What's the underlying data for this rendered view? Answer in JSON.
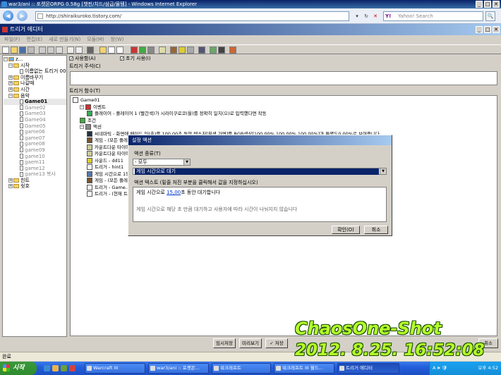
{
  "ie": {
    "title": "war3/ani :: 포켓몬ORPG 0.58g [챗핀/치드/삼급/물템] - Windows Internet Explorer",
    "back": "◀",
    "forward": "▶",
    "url": "http://shiraikuroko.tistory.com/",
    "refresh": "↻",
    "stop": "✕",
    "search_placeholder": "Yahoo! Search",
    "search_logo": "Y!",
    "search_go": "🔍",
    "window_controls": [
      "_",
      "□",
      "✕"
    ]
  },
  "editor": {
    "title": "트리거 에디터",
    "window_controls": [
      "_",
      "□",
      "✕"
    ],
    "menu": [
      "파일(F)",
      "편집(E)",
      "새로 만들기(N)",
      "모듈(M)",
      "창(W)"
    ],
    "tree": [
      {
        "label": "z...",
        "icon": "map-icon",
        "expand": "−",
        "indent": 0
      },
      {
        "label": "시작",
        "icon": "folder-icon",
        "expand": "−",
        "indent": 1
      },
      {
        "label": "이름없는 트리거 006",
        "icon": "trigger-icon",
        "expand": "",
        "indent": 2
      },
      {
        "label": "이름바꾸기",
        "icon": "folder-icon",
        "expand": "+",
        "indent": 1
      },
      {
        "label": "나갈때",
        "icon": "folder-icon",
        "expand": "+",
        "indent": 1
      },
      {
        "label": "시간",
        "icon": "folder-icon",
        "expand": "+",
        "indent": 1
      },
      {
        "label": "음악",
        "icon": "folder-icon",
        "expand": "−",
        "indent": 1
      },
      {
        "label": "Game01",
        "icon": "trigger-icon",
        "expand": "",
        "indent": 2,
        "selected": true
      },
      {
        "label": "Game02",
        "icon": "trigger-icon",
        "expand": "",
        "indent": 2,
        "gray": true
      },
      {
        "label": "Game03",
        "icon": "trigger-icon",
        "expand": "",
        "indent": 2,
        "gray": true
      },
      {
        "label": "Game04",
        "icon": "trigger-icon",
        "expand": "",
        "indent": 2,
        "gray": true
      },
      {
        "label": "Game05",
        "icon": "trigger-icon",
        "expand": "",
        "indent": 2,
        "gray": true
      },
      {
        "label": "game06",
        "icon": "trigger-icon",
        "expand": "",
        "indent": 2,
        "gray": true
      },
      {
        "label": "game07",
        "icon": "trigger-icon",
        "expand": "",
        "indent": 2,
        "gray": true
      },
      {
        "label": "game08",
        "icon": "trigger-icon",
        "expand": "",
        "indent": 2,
        "gray": true
      },
      {
        "label": "game09",
        "icon": "trigger-icon",
        "expand": "",
        "indent": 2,
        "gray": true
      },
      {
        "label": "game10",
        "icon": "trigger-icon",
        "expand": "",
        "indent": 2,
        "gray": true
      },
      {
        "label": "gaem11",
        "icon": "trigger-icon",
        "expand": "",
        "indent": 2,
        "gray": true
      },
      {
        "label": "game12",
        "icon": "trigger-icon",
        "expand": "",
        "indent": 2,
        "gray": true
      },
      {
        "label": "game13 복사",
        "icon": "trigger-icon",
        "expand": "",
        "indent": 2,
        "gray": true
      },
      {
        "label": "힌트",
        "icon": "folder-icon",
        "expand": "+",
        "indent": 1
      },
      {
        "label": "쉿호",
        "icon": "folder-icon",
        "expand": "+",
        "indent": 1
      }
    ],
    "enabled_label": "사용함(A)",
    "initial_on_label": "초기 사용(I)",
    "check_mark": "✓",
    "comment_label": "트리거 주석(C)",
    "functions_label": "트리거 함수(T)",
    "functions": [
      {
        "text": "Game01",
        "icon": "trigger-icon",
        "indent": 0
      },
      {
        "text": "이벤트",
        "icon": "event-icon",
        "indent": 1,
        "expand": "−"
      },
      {
        "text": "플레이어 - 플레이어 1 (빨간색)가 시라이쿠로코(을)를 정확히 일치(으)로 입력했다면 작동",
        "icon": "player-icon",
        "indent": 2
      },
      {
        "text": "조건",
        "icon": "condition-icon",
        "indent": 1,
        "expand": ""
      },
      {
        "text": "액션",
        "icon": "action-icon",
        "indent": 1,
        "expand": "−"
      },
      {
        "text": "씨네마틱 - 화면에 페이드 인(출)를 100,00초 동안 텍스처[흰색 가면]를 RGB색상[100,00%,100,00%,100,00%]과 투명도0,00%로 보여줍니다",
        "icon": "cinematic-icon",
        "indent": 2
      },
      {
        "text": "게임 - (모든 플레이어)에게 (트리거 문...)",
        "icon": "game-icon",
        "indent": 2
      },
      {
        "text": "카운트다운 타이머 -",
        "icon": "timer-icon",
        "indent": 2
      },
      {
        "text": "카운트다운 타이머 -",
        "icon": "timer-icon",
        "indent": 2
      },
      {
        "text": "사운드 - dd11",
        "icon": "sound-icon",
        "indent": 2
      },
      {
        "text": "트리거 - hint1",
        "icon": "trigger-icon",
        "indent": 2
      },
      {
        "text": "게임 시간으로 15,00초...",
        "icon": "wait-icon",
        "indent": 2
      },
      {
        "text": "게임 - (모든 플레이어...)",
        "icon": "game-icon",
        "indent": 2
      },
      {
        "text": "트리거 - Game...",
        "icon": "trigger-icon",
        "indent": 2
      },
      {
        "text": "트리거 - (현재 트리거...)",
        "icon": "trigger-icon",
        "indent": 2
      }
    ],
    "buttons": {
      "temp_save": "임시저장",
      "preview": "미리보기",
      "save": "✓ 저장",
      "cancel": "취소"
    }
  },
  "dialog": {
    "title": "설정 액션",
    "action_type_label": "액션 종류(T)",
    "category_value": "- 모두",
    "action_value": "게임 시간으로 대기",
    "action_text_label": "액션 텍스트 (밑줄 처진 부분을 클릭해서 값을 지정하십시오)",
    "action_text_prefix": "게임 시간으로 ",
    "action_text_link": "15,00",
    "action_text_suffix": "초 동안 대기합니다",
    "description": "게임 시간으로 해당 초 만큼 대기하고 사용자에 따라 시간이 나눠지지 않습니다",
    "ok_label": "확인(O)",
    "cancel_label": "취소"
  },
  "status": {
    "text": "완료"
  },
  "watermark": {
    "line1": "ChaosOne-Shot",
    "line2": "2012. 8.25. 16:52:08"
  },
  "taskbar": {
    "start_label": "시작",
    "tasks": [
      {
        "label": "Warcraft III",
        "active": false
      },
      {
        "label": "war3/ani :: 포켓몬...",
        "active": false
      },
      {
        "label": "워크래프트",
        "active": false
      },
      {
        "label": "워크래프트 III 월드...",
        "active": false
      },
      {
        "label": "트리거 에디터",
        "active": true
      }
    ],
    "tray_text": "A 🕪 🛡",
    "clock": "오후 4:52"
  }
}
